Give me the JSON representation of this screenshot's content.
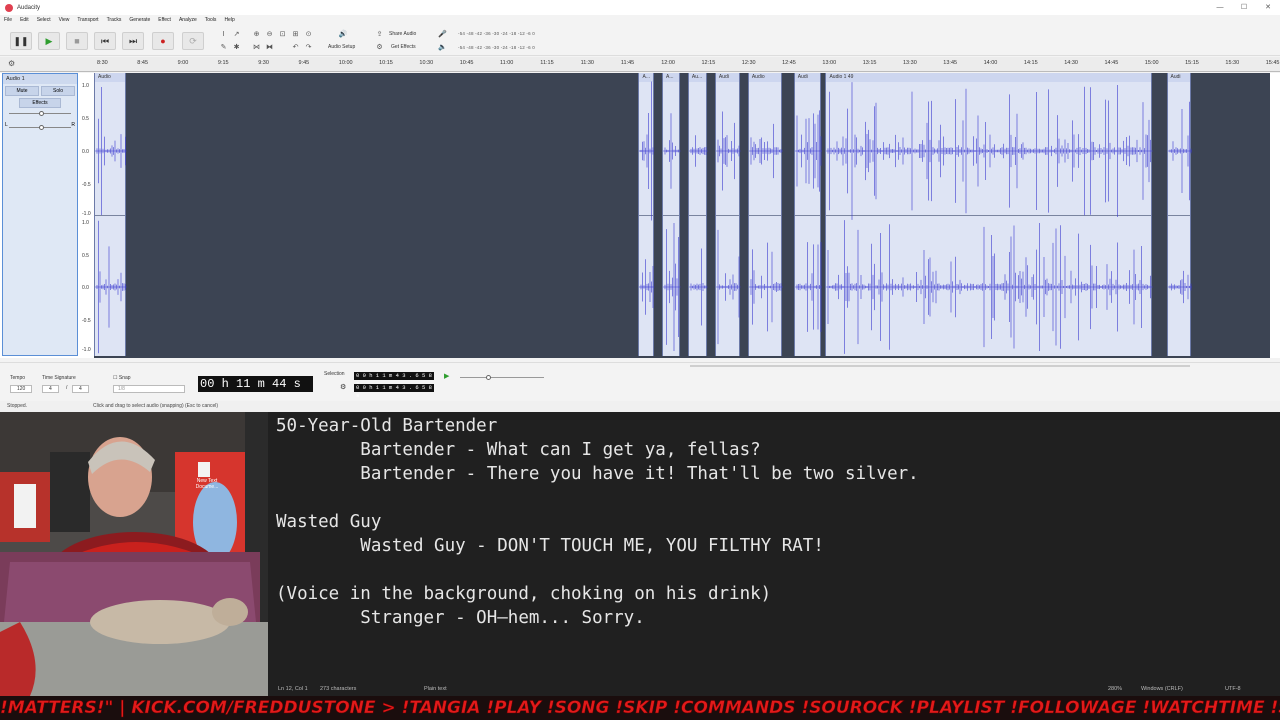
{
  "window": {
    "title": "Audacity",
    "controls": [
      "—",
      "☐",
      "✕"
    ]
  },
  "menu": [
    "File",
    "Edit",
    "Select",
    "View",
    "Transport",
    "Tracks",
    "Generate",
    "Effect",
    "Analyze",
    "Tools",
    "Help"
  ],
  "toolbar": {
    "audio_setup": "Audio Setup",
    "share_audio": "Share Audio",
    "get_effects": "Get Effects",
    "meter_scale": "-54 -48 -42 -36 -30 -24 -18 -12 -6 0"
  },
  "ruler": {
    "ticks": [
      "8:30",
      "8:45",
      "9:00",
      "9:15",
      "9:30",
      "9:45",
      "10:00",
      "10:15",
      "10:30",
      "10:45",
      "11:00",
      "11:15",
      "11:30",
      "11:45",
      "12:00",
      "12:15",
      "12:30",
      "12:45",
      "13:00",
      "13:15",
      "13:30",
      "13:45",
      "14:00",
      "14:15",
      "14:30",
      "14:45",
      "15:00",
      "15:15",
      "15:30",
      "15:45"
    ]
  },
  "track": {
    "name": "Audio 1",
    "mute": "Mute",
    "solo": "Solo",
    "effects": "Effects",
    "gain_left": "L",
    "gain_right": "R",
    "scale_labels": [
      "1.0",
      "0.5",
      "0.0",
      "-0.5",
      "-1.0"
    ],
    "clips": [
      {
        "label": "Audio",
        "start": 0.0,
        "end": 0.027
      },
      {
        "label": "A...",
        "start": 0.463,
        "end": 0.476
      },
      {
        "label": "A...",
        "start": 0.483,
        "end": 0.498
      },
      {
        "label": "Au...",
        "start": 0.505,
        "end": 0.521
      },
      {
        "label": "Audi",
        "start": 0.528,
        "end": 0.549
      },
      {
        "label": "Audio",
        "start": 0.556,
        "end": 0.585
      },
      {
        "label": "Audi",
        "start": 0.595,
        "end": 0.618
      },
      {
        "label": "Audio 1 49",
        "start": 0.622,
        "end": 0.9
      },
      {
        "label": "Audi",
        "start": 0.912,
        "end": 0.933
      }
    ]
  },
  "bottom": {
    "tempo_label": "Tempo",
    "tempo_value": "120",
    "time_sig_label": "Time Signature",
    "time_sig_num": "4",
    "time_sig_den": "4",
    "snap_label": "Snap",
    "snap_value": "1/8",
    "time": "00 h 11 m 44 s",
    "selection_label": "Selection",
    "sel_start": "0 0 h 1 1 m 4 3 . 6 5 8 s",
    "sel_end": "0 0 h 1 1 m 4 3 . 6 5 8 s"
  },
  "status": {
    "state": "Stopped.",
    "hint": "Click and drag to select audio (snapping) (Esc to cancel)"
  },
  "editor": {
    "lines": [
      "50-Year-Old Bartender",
      "        Bartender - What can I get ya, fellas?",
      "        Bartender - There you have it! That'll be two silver.",
      "",
      "Wasted Guy",
      "        Wasted Guy - DON'T TOUCH ME, YOU FILTHY RAT!",
      "",
      "(Voice in the background, choking on his drink)",
      "        Stranger - OH—hem... Sorry."
    ],
    "cursor_pos": "Ln 12, Col 1",
    "char_count": "273 characters",
    "file_type": "Plain text",
    "zoom": "280%",
    "line_ending": "Windows (CRLF)",
    "encoding": "UTF-8"
  },
  "desktop_icon": {
    "label": "New Text Docume..."
  },
  "ticker": "!MATTERS!\"  |  KICK.COM/FREDDUSTONE  >   !TANGIA !PLAY !SONG !SKIP !COMMANDS !SOUROCK  !PLAYLIST  !FOLLOWAGE  !WATCHTIME  !SOCIAL",
  "colors": {
    "accent": "#5b8fd6",
    "waveform": "#3a3ad0",
    "ticker": "#e21a1a",
    "record": "#cc2222",
    "play": "#2e9d2e"
  }
}
